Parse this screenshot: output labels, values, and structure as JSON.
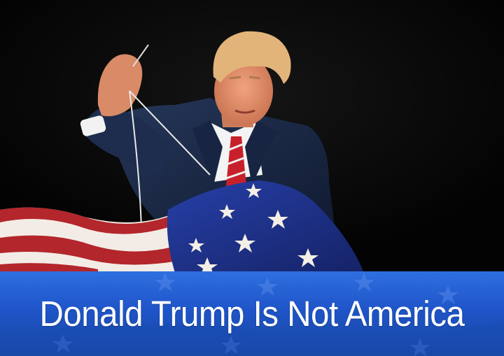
{
  "headline": {
    "text": "Donald Trump Is Not America"
  },
  "colors": {
    "background": "#040404",
    "banner_blue": "#1f55c9",
    "flag_blue": "#1d2f8a",
    "flag_red": "#b3262b",
    "flag_white": "#f3ece6",
    "suit": "#1b2a4a",
    "tie_red": "#c8202a",
    "hair": "#e3b47a"
  },
  "image": {
    "subject": "person-sewing-flag",
    "elements": [
      "needle-icon",
      "thread",
      "american-flag",
      "stars"
    ]
  }
}
